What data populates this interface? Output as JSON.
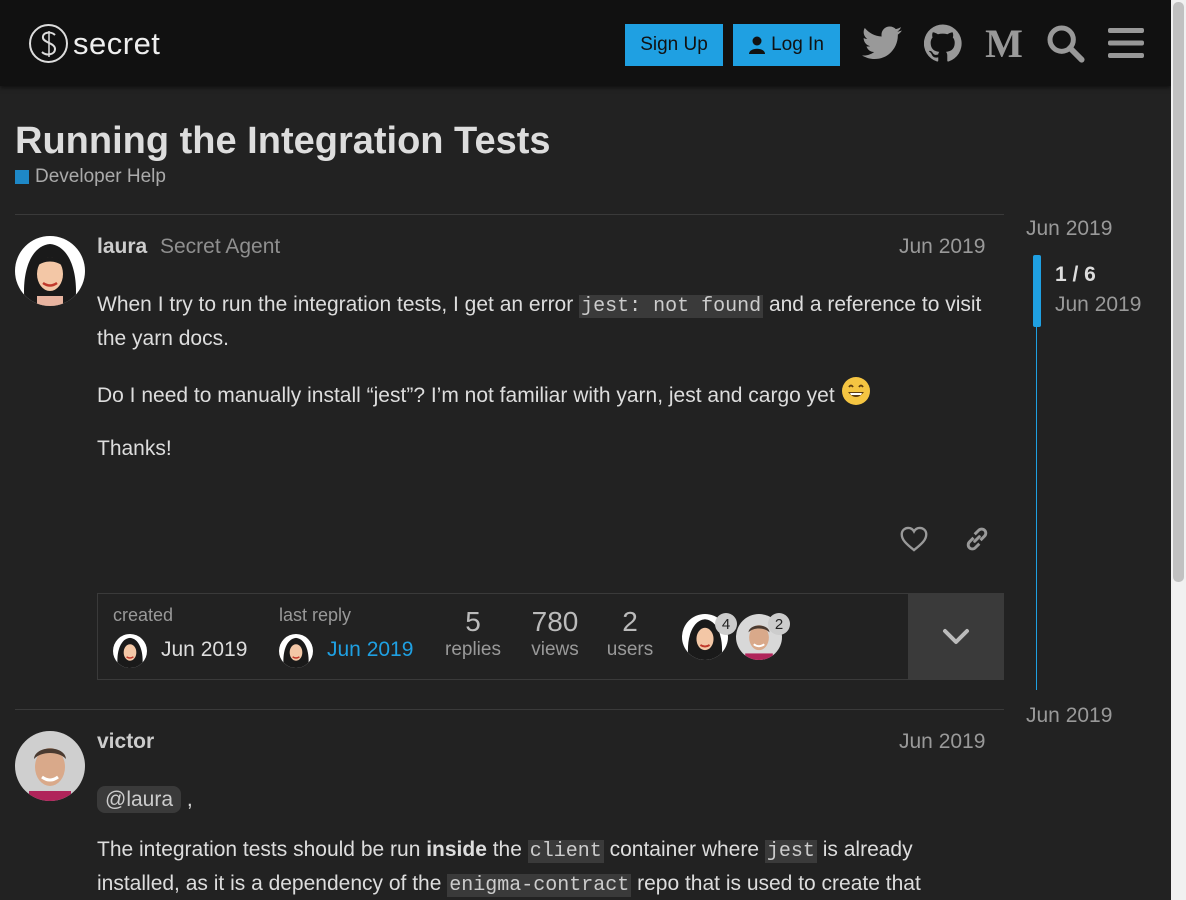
{
  "header": {
    "logo_text": "secret",
    "signup_label": "Sign Up",
    "login_label": "Log In",
    "icons": [
      "twitter-icon",
      "github-icon",
      "medium-icon",
      "search-icon",
      "menu-icon"
    ]
  },
  "topic": {
    "title": "Running the Integration Tests",
    "category": "Developer Help",
    "category_color": "#1e88c7"
  },
  "posts": [
    {
      "author": "laura",
      "user_title": "Secret Agent",
      "date": "Jun 2019",
      "p1_a": "When I try to run the integration tests, I get an error ",
      "p1_code": "jest: not found",
      "p1_b": " and a reference to visit the yarn docs.",
      "p2": "Do I need to manually install “jest”? I’m not familiar with yarn, jest and cargo yet ",
      "p3": "Thanks!"
    },
    {
      "author": "victor",
      "date": "Jun 2019",
      "mention": "@laura",
      "mention_after": " ,",
      "p2_a": "The integration tests should be run ",
      "p2_bold": "inside",
      "p2_b": " the ",
      "p2_code1": "client",
      "p2_c": " container where ",
      "p2_code2": "jest",
      "p2_d": " is already installed, as it is a dependency of the ",
      "p2_code3": "enigma-contract",
      "p2_e": " repo that is used to create that"
    }
  ],
  "topic_map": {
    "created_label": "created",
    "created_date": "Jun 2019",
    "last_reply_label": "last reply",
    "last_reply_date": "Jun 2019",
    "replies": "5",
    "replies_label": "replies",
    "views": "780",
    "views_label": "views",
    "users": "2",
    "users_label": "users",
    "participants": [
      {
        "name": "laura",
        "count": "4"
      },
      {
        "name": "victor",
        "count": "2"
      }
    ]
  },
  "timeline": {
    "start_date": "Jun 2019",
    "position": "1 / 6",
    "position_date": "Jun 2019",
    "end_date": "Jun 2019"
  },
  "colors": {
    "accent": "#1fa0e2",
    "background": "#222222",
    "header_bg": "#111111"
  }
}
